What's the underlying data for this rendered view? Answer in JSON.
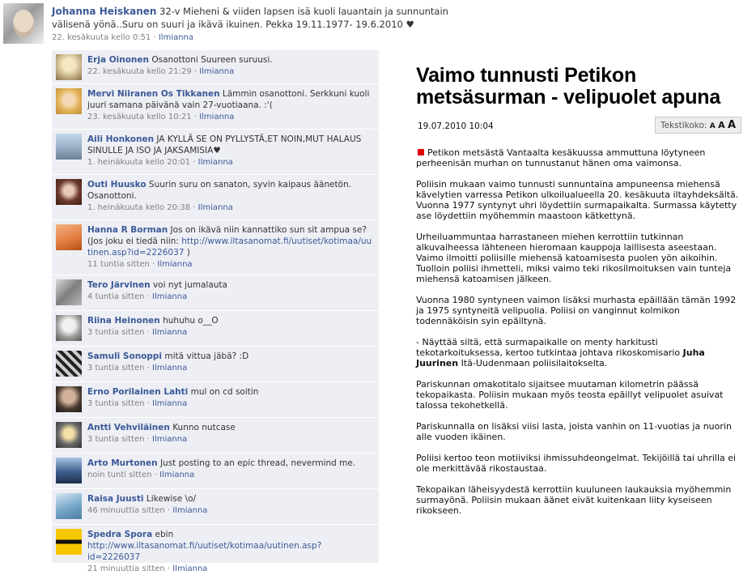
{
  "status": {
    "author": "Johanna Heiskanen",
    "text": "32-v Mieheni & viiden lapsen isä kuoli lauantain ja sunnuntain välisenä yönä..Suru on suuri ja ikävä ikuinen. Pekka 19.11.1977- 19.6.2010 ♥",
    "time": "22. kesäkuuta kello 0:51",
    "report": "Ilmianna"
  },
  "comments": [
    {
      "author": "Erja Oinonen",
      "text": "Osanottoni Suureen suruusi.",
      "time": "22. kesäkuuta kello 21:29",
      "report": "Ilmianna"
    },
    {
      "author": "Mervi Niiranen Os Tikkanen",
      "text": "Lämmin osanottoni. Serkkuni kuoli juuri samana päivänä vain 27-vuotiaana. :'(",
      "time": "23. kesäkuuta kello 10:21",
      "report": "Ilmianna"
    },
    {
      "author": "Aili Honkonen",
      "text": "JA KYLLÄ SE ON PYLLYSTÄ,ET NOIN,MUT HALAUS SINULLE JA ISO JA JAKSAMISIA♥",
      "time": "1. heinäkuuta kello 20:01",
      "report": "Ilmianna"
    },
    {
      "author": "Outi Huusko",
      "text": "Suurin suru on sanaton, syvin kaipaus äänetön. Osanottoni.",
      "time": "1. heinäkuuta kello 20:38",
      "report": "Ilmianna"
    },
    {
      "author": "Hanna R Borman",
      "text": "Jos on ikävä niin kannattiko sun sit ampua se? (Jos joku ei tiedä niin:",
      "link": "http://www.iltasanomat.fi/uutiset/kotimaa/uutinen.asp?id=2226037",
      "tail": ")",
      "time": "11 tuntia sitten",
      "report": "Ilmianna"
    },
    {
      "author": "Tero Järvinen",
      "text": "voi nyt jumalauta",
      "time": "4 tuntia sitten",
      "report": "Ilmianna"
    },
    {
      "author": "Riina Heinonen",
      "text": "huhuhu o__O",
      "time": "3 tuntia sitten",
      "report": "Ilmianna"
    },
    {
      "author": "Samuli Sonoppi",
      "text": "mitä vittua jäbä? :D",
      "time": "3 tuntia sitten",
      "report": "Ilmianna"
    },
    {
      "author": "Erno Porilainen Lahti",
      "text": "mul on cd soitin",
      "time": "3 tuntia sitten",
      "report": "Ilmianna"
    },
    {
      "author": "Antti Vehviläinen",
      "text": "Kunno nutcase",
      "time": "3 tuntia sitten",
      "report": "Ilmianna"
    },
    {
      "author": "Arto Murtonen",
      "text": "Just posting to an epic thread, nevermind me.",
      "time": "noin tunti sitten",
      "report": "Ilmianna"
    },
    {
      "author": "Raisa Juusti",
      "text": "Likewise \\o/",
      "time": "46 minuuttia sitten",
      "report": "Ilmianna"
    },
    {
      "author": "Spedra Spora",
      "text": "ebin",
      "link": "http://www.iltasanomat.fi/uutiset/kotimaa/uutinen.asp?id=2226037",
      "time": "21 minuuttia sitten",
      "report": "Ilmianna"
    }
  ],
  "article": {
    "title": "Vaimo tunnusti Petikon metsäsurman - velipuolet apuna",
    "date": "19.07.2010 10:04",
    "size_label": "Tekstikoko:",
    "size_a1": "A",
    "size_a2": "A",
    "size_a3": "A",
    "p1": "Petikon metsästä Vantaalta kesäkuussa ammuttuna löytyneen perheenisän murhan on tunnustanut hänen oma vaimonsa.",
    "p2": "Poliisin mukaan vaimo tunnusti sunnuntaina ampuneensa miehensä kävelytien varressa Petikon ulkoilualueella 20. kesäkuuta iltayhdeksältä. Vuonna 1977 syntynyt uhri löydettiin surmapaikalta. Surmassa käytetty ase löydettiin myöhemmin maastoon kätkettynä.",
    "p3": "Urheiluammuntaa harrastaneen miehen kerrottiin tutkinnan alkuvaiheessa lähteneen hieromaan kauppoja laillisesta aseestaan. Vaimo ilmoitti poliisille miehensä katoamisesta puolen yön aikoihin. Tuolloin poliisi ihmetteli, miksi vaimo teki rikosilmoituksen vain tunteja miehensä katoamisen jälkeen.",
    "p4": "Vuonna 1980 syntyneen vaimon lisäksi murhasta epäillään tämän 1992 ja 1975 syntyneitä velipuolia. Poliisi on vanginnut kolmikon todennäköisin syin epäiltynä.",
    "p5a": "- Näyttää siltä, että surmapaikalle on menty harkitusti tekotarkoituksessa, kertoo tutkintaa johtava rikoskomisario",
    "p5b": "Juha Juurinen",
    "p5c": "Itä-Uudenmaan poliisilaitokselta.",
    "p6": "Pariskunnan omakotitalo sijaitsee muutaman kilometrin päässä tekopaikasta. Poliisin mukaan myös teosta epäillyt velipuolet asuivat talossa tekohetkellä.",
    "p7": "Pariskunnalla on lisäksi viisi lasta, joista vanhin on 11-vuotias ja nuorin alle vuoden ikäinen.",
    "p8": "Poliisi kertoo teon motiiviksi ihmissuhdeongelmat. Tekijöillä tai uhrilla ei ole merkittävää rikostaustaa.",
    "p9": "Tekopaikan läheisyydestä kerrottiin kuuluneen laukauksia myöhemmin surmayönä. Poliisin mukaan äänet eivät kuitenkaan liity kyseiseen rikokseen."
  }
}
